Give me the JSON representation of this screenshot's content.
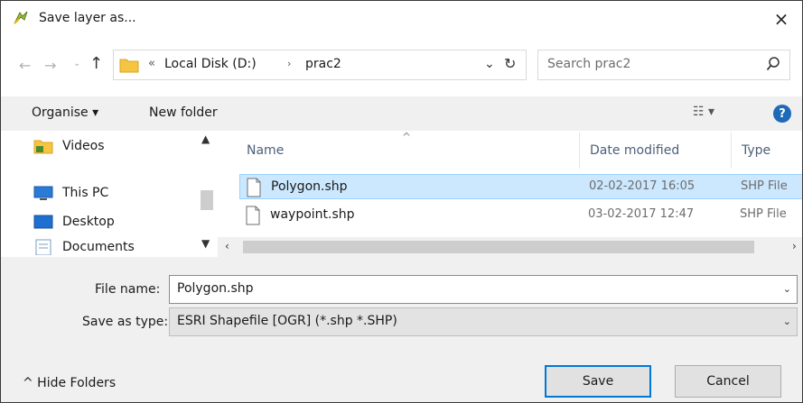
{
  "window": {
    "title": "Save layer as...",
    "close_label": "×"
  },
  "nav": {
    "back_icon": "←",
    "forward_icon": "→",
    "recent_icon": "⌄",
    "up_icon": "↑",
    "crumb_prefix": "«",
    "breadcrumbs": [
      "Local Disk (D:)",
      "prac2"
    ],
    "separator": "›",
    "dropdown_icon": "⌄",
    "refresh_icon": "↻"
  },
  "search": {
    "placeholder": "Search prac2"
  },
  "toolbar": {
    "organise_label": "Organise ▾",
    "new_folder_label": "New folder",
    "view_label": "☷ ▾",
    "help_label": "?"
  },
  "sidebar": {
    "items": [
      {
        "label": "Videos",
        "icon": "videos-folder-icon"
      },
      {
        "label": "This PC",
        "icon": "this-pc-icon"
      },
      {
        "label": "Desktop",
        "icon": "desktop-icon"
      },
      {
        "label": "Documents",
        "icon": "documents-icon"
      }
    ]
  },
  "filelist": {
    "columns": [
      "Name",
      "Date modified",
      "Type"
    ],
    "sort_indicator": "^",
    "rows": [
      {
        "name": "Polygon.shp",
        "date": "02-02-2017 16:05",
        "type": "SHP File",
        "selected": true
      },
      {
        "name": "waypoint.shp",
        "date": "03-02-2017 12:47",
        "type": "SHP File",
        "selected": false
      }
    ]
  },
  "form": {
    "file_name_label": "File name:",
    "file_name_value": "Polygon.shp",
    "save_as_type_label": "Save as type:",
    "save_as_type_value": "ESRI Shapefile [OGR] (*.shp *.SHP)"
  },
  "footer": {
    "hide_folders_label": "^ Hide Folders",
    "save_label": "Save",
    "cancel_label": "Cancel"
  },
  "colors": {
    "selection_bg": "#cce8ff",
    "accent": "#0078d7",
    "help_blue": "#1e6ab8"
  }
}
